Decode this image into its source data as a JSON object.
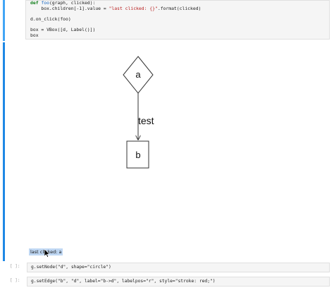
{
  "code_cell": {
    "lines": [
      {
        "parts": [
          [
            "kw",
            "def "
          ],
          [
            "fn",
            "foo"
          ],
          [
            "",
            "(graph, clicked):"
          ]
        ]
      },
      {
        "parts": [
          [
            "",
            "    box.children[-1].value = "
          ],
          [
            "str",
            "\"last clicked: {}\""
          ],
          [
            "",
            ".format(clicked)"
          ]
        ]
      },
      {
        "parts": [
          [
            "",
            ""
          ]
        ]
      },
      {
        "parts": [
          [
            "",
            "d.on_click(foo)"
          ]
        ]
      },
      {
        "parts": [
          [
            "",
            ""
          ]
        ]
      },
      {
        "parts": [
          [
            "",
            "box = VBox([d, Label()])"
          ]
        ]
      },
      {
        "parts": [
          [
            "",
            "box"
          ]
        ]
      }
    ]
  },
  "graph": {
    "node_a_label": "a",
    "node_b_label": "b",
    "edge_label": "test"
  },
  "output": {
    "last_clicked": "last clicked: a"
  },
  "cells": [
    {
      "prompt": "[ ]:",
      "code": "g.setNode(\"d\", shape=\"circle\")"
    },
    {
      "prompt": "[ ]:",
      "code": "g.setEdge(\"b\", \"d\", label=\"b->d\", labelpos=\"r\", style=\"stroke: red;\")"
    }
  ],
  "colors": {
    "cell_bar": "#1e88e5",
    "selection": "#bfd7f3"
  },
  "icons": {
    "cursor": "arrow-cursor-icon"
  }
}
